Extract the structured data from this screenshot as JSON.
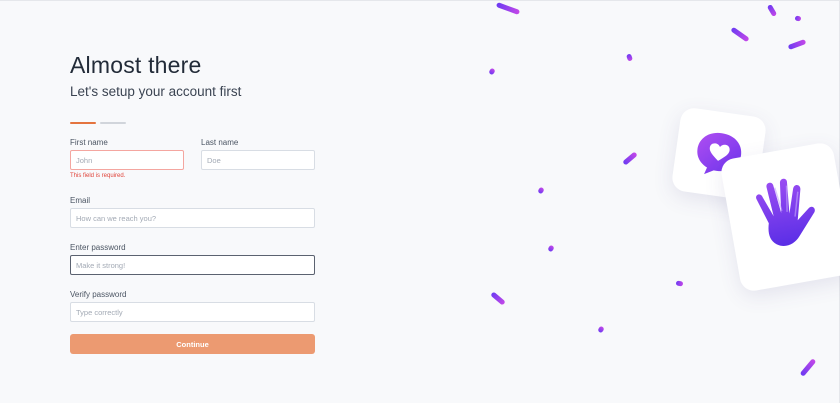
{
  "header": {
    "title": "Almost there",
    "subtitle": "Let's setup your account first"
  },
  "steps": {
    "total": 2,
    "current": 1
  },
  "form": {
    "first_name": {
      "label": "First name",
      "placeholder": "John",
      "value": "",
      "error": "This field is required."
    },
    "last_name": {
      "label": "Last name",
      "placeholder": "Doe",
      "value": ""
    },
    "email": {
      "label": "Email",
      "placeholder": "How can we reach you?",
      "value": ""
    },
    "password": {
      "label": "Enter password",
      "placeholder": "Make it strong!",
      "value": ""
    },
    "verify_password": {
      "label": "Verify password",
      "placeholder": "Type correctly",
      "value": ""
    },
    "submit_label": "Continue"
  },
  "icons": {
    "chat": "chat-bubble-heart-icon",
    "hand": "waving-hand-icon",
    "confetti": "confetti-squiggle"
  },
  "colors": {
    "accent": "#e4743f",
    "button": "#ec9a71",
    "error": "#e0443a",
    "illustration_purple": "#7b3cf0"
  }
}
